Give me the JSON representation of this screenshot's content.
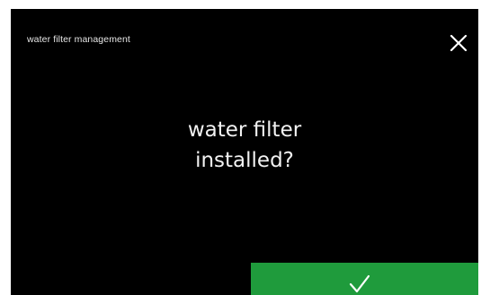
{
  "header": {
    "title": "water filter management"
  },
  "close_button": {
    "icon": "close-icon"
  },
  "prompt": {
    "line1": "water filter",
    "line2": "installed?"
  },
  "confirm_button": {
    "icon": "check-icon"
  },
  "colors": {
    "background": "#000000",
    "text": "#f2f2f2",
    "confirm": "#1f9b3c"
  }
}
